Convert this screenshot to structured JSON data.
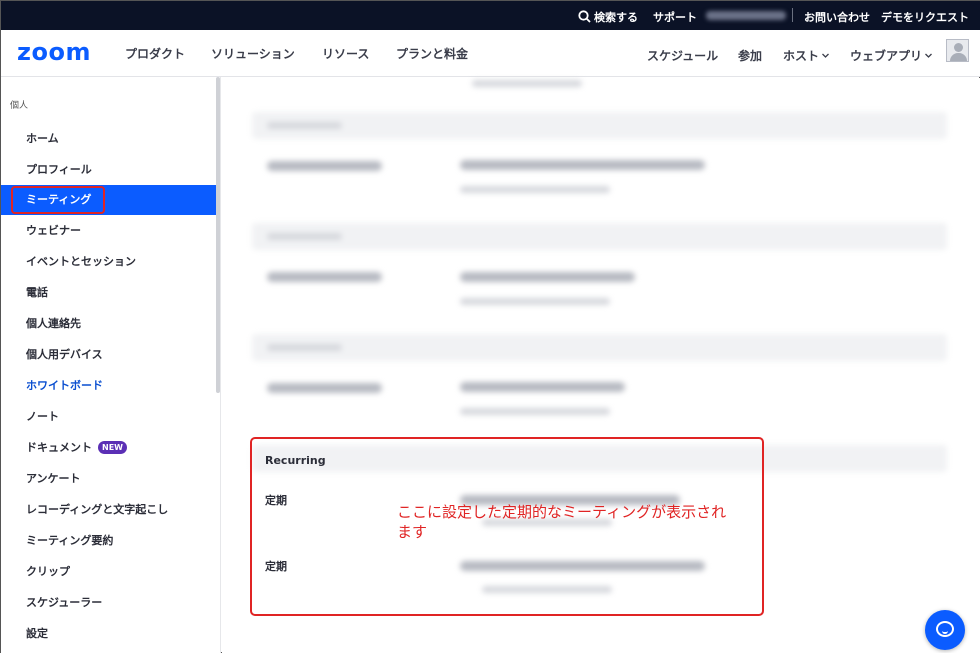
{
  "topbar": {
    "search": "検索する",
    "support": "サポート",
    "contact": "お問い合わせ",
    "demo": "デモをリクエスト"
  },
  "header": {
    "logo": "zoom",
    "nav": [
      "プロダクト",
      "ソリューション",
      "リソース",
      "プランと料金"
    ],
    "right": {
      "schedule": "スケジュール",
      "join": "参加",
      "host": "ホスト",
      "webapp": "ウェブアプリ"
    }
  },
  "sidebar": {
    "section": "個人",
    "items": [
      {
        "label": "ホーム"
      },
      {
        "label": "プロフィール"
      },
      {
        "label": "ミーティング"
      },
      {
        "label": "ウェビナー"
      },
      {
        "label": "イベントとセッション"
      },
      {
        "label": "電話"
      },
      {
        "label": "個人連絡先"
      },
      {
        "label": "個人用デバイス"
      },
      {
        "label": "ホワイトボード"
      },
      {
        "label": "ノート"
      },
      {
        "label": "ドキュメント",
        "badge": "NEW"
      },
      {
        "label": "アンケート"
      },
      {
        "label": "レコーディングと文字起こし"
      },
      {
        "label": "ミーティング要約"
      },
      {
        "label": "クリップ"
      },
      {
        "label": "スケジューラー"
      },
      {
        "label": "設定"
      }
    ]
  },
  "main": {
    "recurring_title": "Recurring",
    "recurring_rows": [
      {
        "label": "定期"
      },
      {
        "label": "定期"
      }
    ]
  },
  "annotation": {
    "text": "ここに設定した定期的なミーティングが表示されます"
  },
  "colors": {
    "brand": "#0b5cff",
    "topbar": "#0b1226",
    "annotation": "#e02424"
  }
}
